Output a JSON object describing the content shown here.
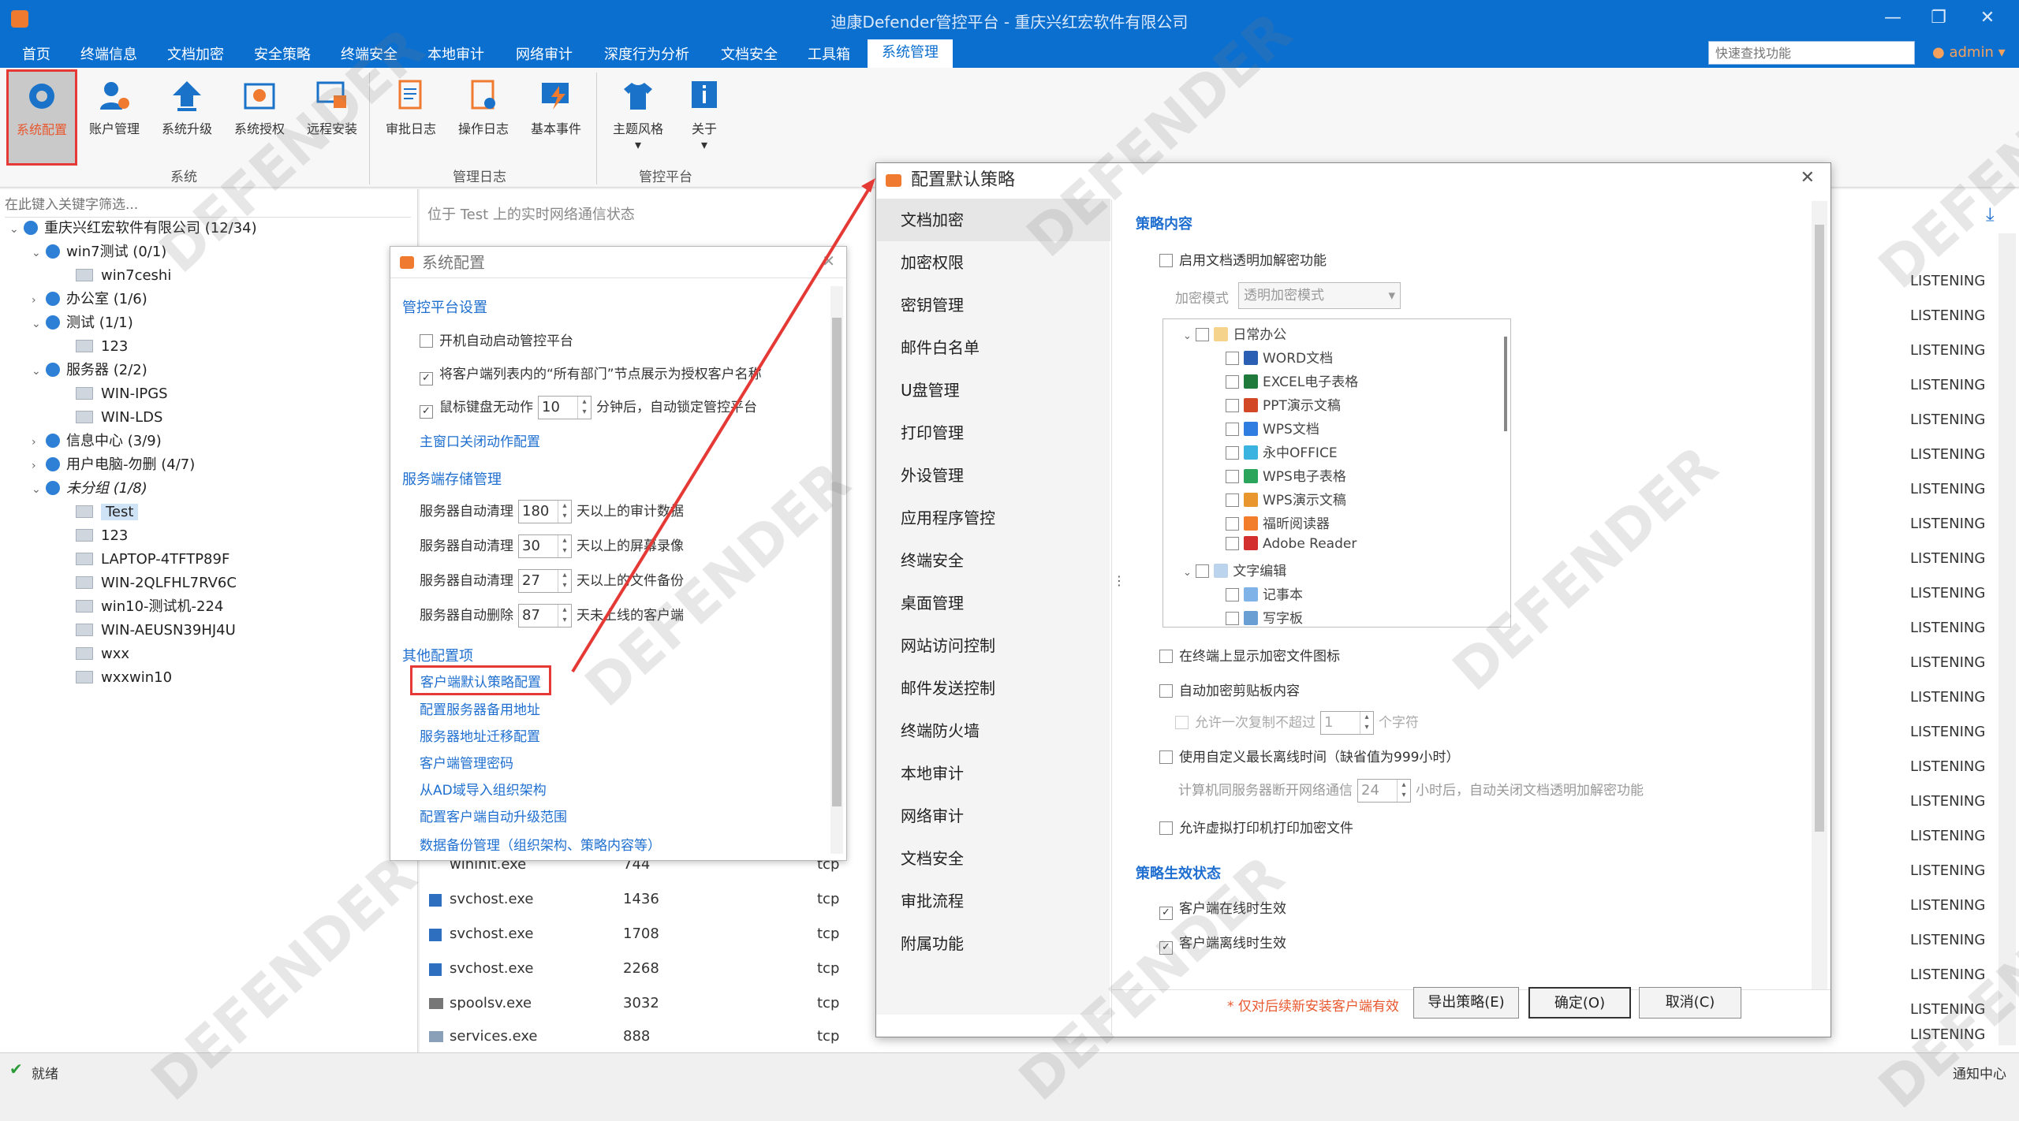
{
  "window": {
    "title": "迪康Defender管控平台 - 重庆兴红宏软件有限公司"
  },
  "menu": {
    "items": [
      "首页",
      "终端信息",
      "文档加密",
      "安全策略",
      "终端安全",
      "本地审计",
      "网络审计",
      "深度行为分析",
      "文档安全",
      "工具箱",
      "系统管理"
    ],
    "active": "系统管理",
    "quick_search_placeholder": "快速查找功能",
    "user": "admin"
  },
  "ribbon": {
    "buttons": [
      "系统配置",
      "账户管理",
      "系统升级",
      "系统授权",
      "远程安装",
      "审批日志",
      "操作日志",
      "基本事件",
      "主题风格",
      "关于"
    ],
    "groups": [
      "系统",
      "管理日志",
      "管控平台"
    ]
  },
  "tree": {
    "search_placeholder": "在此键入关键字筛选...",
    "nodes": [
      "重庆兴红宏软件有限公司 (12/34)",
      "win7测试 (0/1)",
      "win7ceshi",
      "办公室 (1/6)",
      "测试 (1/1)",
      "123",
      "服务器 (2/2)",
      "WIN-IPGS",
      "WIN-LDS",
      "信息中心 (3/9)",
      "用户电脑-勿删 (4/7)",
      "未分组 (1/8)",
      "Test",
      "123",
      "LAPTOP-4TFTP89F",
      "WIN-2QLFHL7RV6C",
      "win10-测试机-224",
      "WIN-AEUSN39HJ4U",
      "wxx",
      "wxxwin10"
    ]
  },
  "main": {
    "status_line": "位于 Test 上的实时网络通信状态",
    "listening": "LISTENING",
    "processes": [
      {
        "name": "wininit.exe",
        "pid": "744",
        "proto": "tcp"
      },
      {
        "name": "svchost.exe",
        "pid": "1436",
        "proto": "tcp"
      },
      {
        "name": "svchost.exe",
        "pid": "1708",
        "proto": "tcp"
      },
      {
        "name": "svchost.exe",
        "pid": "2268",
        "proto": "tcp"
      },
      {
        "name": "spoolsv.exe",
        "pid": "3032",
        "proto": "tcp"
      },
      {
        "name": "services.exe",
        "pid": "888",
        "proto": "tcp"
      }
    ]
  },
  "sysconfig": {
    "title": "系统配置",
    "sec1": "管控平台设置",
    "opt1": "开机自动启动管控平台",
    "opt2": "将客户端列表内的“所有部门”节点展示为授权客户名称",
    "opt3a": "鼠标键盘无动作",
    "opt3v": "10",
    "opt3b": "分钟后，自动锁定管控平台",
    "link1": "主窗口关闭动作配置",
    "sec2": "服务端存储管理",
    "store": [
      {
        "label": "服务器自动清理",
        "value": "180",
        "suffix": "天以上的审计数据"
      },
      {
        "label": "服务器自动清理",
        "value": "30",
        "suffix": "天以上的屏幕录像"
      },
      {
        "label": "服务器自动清理",
        "value": "27",
        "suffix": "天以上的文件备份"
      },
      {
        "label": "服务器自动删除",
        "value": "87",
        "suffix": "天未上线的客户端"
      }
    ],
    "sec3": "其他配置项",
    "links": [
      "客户端默认策略配置",
      "配置服务器备用地址",
      "服务器地址迁移配置",
      "客户端管理密码",
      "从AD域导入组织架构",
      "配置客户端自动升级范围",
      "数据备份管理（组织架构、策略内容等）"
    ]
  },
  "policy": {
    "title": "配置默认策略",
    "nav": [
      "文档加密",
      "加密权限",
      "密钥管理",
      "邮件白名单",
      "U盘管理",
      "打印管理",
      "外设管理",
      "应用程序管控",
      "终端安全",
      "桌面管理",
      "网站访问控制",
      "邮件发送控制",
      "终端防火墙",
      "本地审计",
      "网络审计",
      "文档安全",
      "审批流程",
      "附属功能"
    ],
    "content_title": "策略内容",
    "enable_label": "启用文档透明加解密功能",
    "mode_label": "加密模式",
    "mode_value": "透明加密模式",
    "tree": [
      "日常办公",
      "WORD文档",
      "EXCEL电子表格",
      "PPT演示文稿",
      "WPS文档",
      "永中OFFICE",
      "WPS电子表格",
      "WPS演示文稿",
      "福昕阅读器",
      "Adobe Reader",
      "文字编辑",
      "记事本",
      "写字板"
    ],
    "opt_icon": "在终端上显示加密文件图标",
    "opt_clip": "自动加密剪贴板内容",
    "opt_copy_a": "允许一次复制不超过",
    "opt_copy_v": "1",
    "opt_copy_b": "个字符",
    "opt_offline": "使用自定义最长离线时间（缺省值为999小时）",
    "offline_a": "计算机同服务器断开网络通信",
    "offline_v": "24",
    "offline_b": "小时后，自动关闭文档透明加解密功能",
    "opt_vprint": "允许虚拟打印机打印加密文件",
    "status_title": "策略生效状态",
    "online": "客户端在线时生效",
    "offline": "客户端离线时生效",
    "note": "* 仅对后续新安装客户端有效",
    "btn_export": "导出策略(E)",
    "btn_ok": "确定(O)",
    "btn_cancel": "取消(C)"
  },
  "statusbar": {
    "left": "就绪",
    "right": "通知中心"
  },
  "watermark": "DEFENDER 迪 康 软 件"
}
